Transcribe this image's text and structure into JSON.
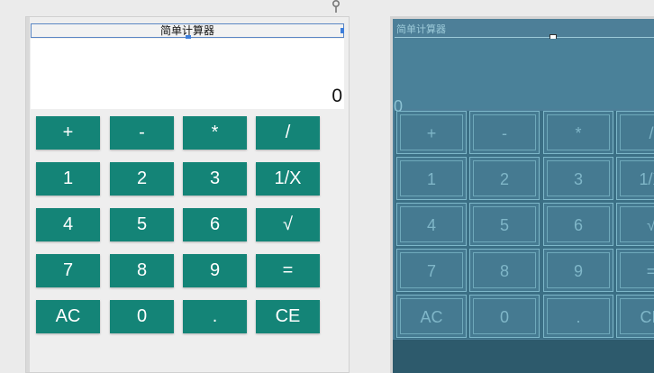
{
  "app": {
    "title": "简单计算器"
  },
  "display": {
    "value": "0"
  },
  "buttons": {
    "row1": [
      "+",
      "-",
      "*",
      "/"
    ],
    "row2": [
      "1",
      "2",
      "3",
      "1/X"
    ],
    "row3": [
      "4",
      "5",
      "6",
      "√"
    ],
    "row4": [
      "7",
      "8",
      "9",
      "="
    ],
    "row5": [
      "AC",
      "0",
      ".",
      "CE"
    ]
  },
  "colors": {
    "button_bg": "#148477",
    "button_text": "#ffffff",
    "panel_bg": "#eeeeee",
    "blueprint_bg": "#4d7f98"
  },
  "icons": {
    "pin": "pin-icon"
  }
}
